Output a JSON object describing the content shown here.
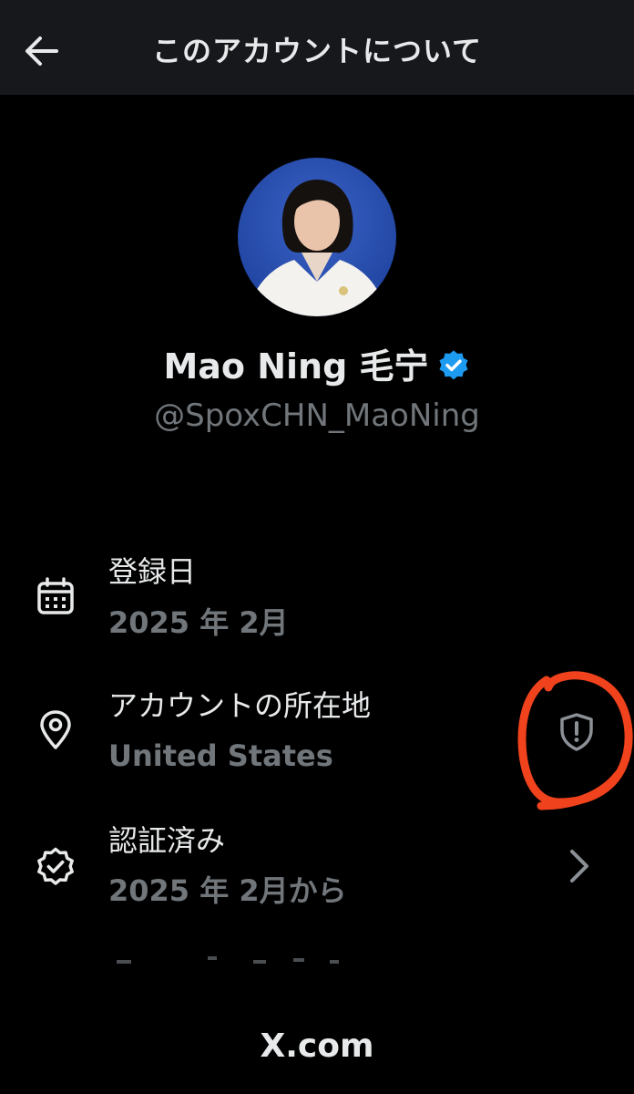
{
  "header": {
    "title": "このアカウントについて",
    "back_icon": "arrow-left-icon"
  },
  "profile": {
    "name": "Mao Ning 毛宁",
    "handle": "@SpoxCHN_MaoNing",
    "verified_color": "#1d9bf0"
  },
  "details": [
    {
      "icon": "calendar-icon",
      "label": "登録日",
      "value": "2025 年 2月"
    },
    {
      "icon": "location-pin-icon",
      "label": "アカウントの所在地",
      "value": "United States",
      "action_icon": "shield-alert-icon"
    },
    {
      "icon": "verified-badge-icon",
      "label": "認証済み",
      "value": "2025 年 2月から",
      "action_icon": "chevron-right-icon"
    }
  ],
  "footer": {
    "brand": "X.com"
  },
  "colors": {
    "background": "#000000",
    "header_bg": "#16181c",
    "primary_text": "#e7e9ea",
    "secondary_text": "#71767b",
    "accent_blue": "#1d9bf0",
    "annotation_red": "#f0421c"
  }
}
